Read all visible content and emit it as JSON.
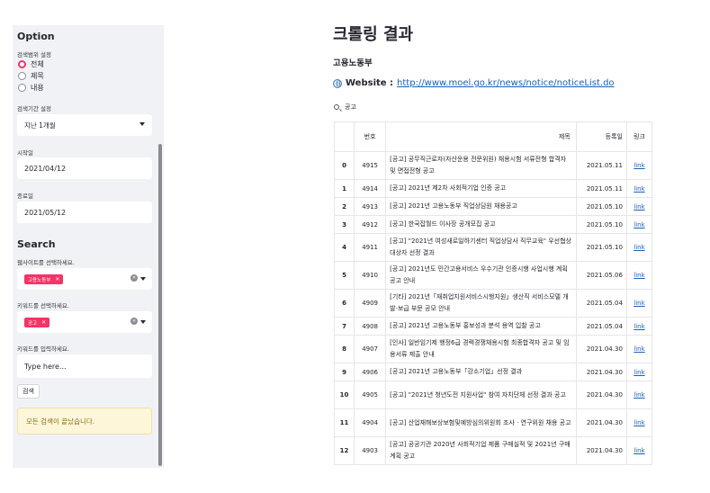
{
  "sidebar": {
    "option_title": "Option",
    "search_range_label": "검색범위 설정",
    "radio_options": [
      {
        "label": "전체",
        "checked": true
      },
      {
        "label": "제목",
        "checked": false
      },
      {
        "label": "내용",
        "checked": false
      }
    ],
    "period_label": "검색기간 설정",
    "period_value": "지난 1개월",
    "start_label": "시작일",
    "start_value": "2021/04/12",
    "end_label": "종료일",
    "end_value": "2021/05/12",
    "search_title": "Search",
    "website_label": "웹사이트를 선택하세요.",
    "website_tag": "고용노동부",
    "keyword_label": "키워드를 선택하세요.",
    "keyword_tag": "공고",
    "input_label": "키워드를 입력하세요.",
    "input_placeholder": "Type here...",
    "search_button": "검색",
    "info_message": "모든 검색이 끝났습니다."
  },
  "main": {
    "title": "크롤링 결과",
    "subtitle": "고용노동부",
    "website_label": "Website :",
    "website_url": "http://www.moel.go.kr/news/notice/noticeList.do",
    "search_keyword": "공고",
    "table": {
      "headers": [
        "",
        "번호",
        "제목",
        "등록일",
        "링크"
      ],
      "rows": [
        {
          "idx": "0",
          "num": "4915",
          "title": "[공고] 공무직근로자(자산운용 전문위원) 채용시험 서류전형 합격자 및 면접전형 공고",
          "date": "2021.05.11",
          "link": "link"
        },
        {
          "idx": "1",
          "num": "4914",
          "title": "[공고] 2021년 제2차 사회적기업 인증 공고",
          "date": "2021.05.11",
          "link": "link"
        },
        {
          "idx": "2",
          "num": "4913",
          "title": "[공고] 2021년 고용노동부 직업상담원 채용공고",
          "date": "2021.05.10",
          "link": "link"
        },
        {
          "idx": "3",
          "num": "4912",
          "title": "[공고] 한국잡월드 이사장 공개모집 공고",
          "date": "2021.05.10",
          "link": "link"
        },
        {
          "idx": "4",
          "num": "4911",
          "title": "[공고] \"2021년 여성새로일하기센터 직업상담사 직무교육\" 우선협상 대상자 선정 결과",
          "date": "2021.05.10",
          "link": "link"
        },
        {
          "idx": "5",
          "num": "4910",
          "title": "[공고] 2021년도 민간고용서비스 우수기관 인증시행 사업시행 계획공고 안내",
          "date": "2021.05.06",
          "link": "link"
        },
        {
          "idx": "6",
          "num": "4909",
          "title": "[기타] 2021년「재취업지원서비스시행지원」생산직 서비스모델 개발·보급 부문 공모 안내",
          "date": "2021.05.04",
          "link": "link"
        },
        {
          "idx": "7",
          "num": "4908",
          "title": "[공고] 2021년 고용노동부 홍보성과 분석 용역 입찰 공고",
          "date": "2021.05.04",
          "link": "link"
        },
        {
          "idx": "8",
          "num": "4907",
          "title": "[인사] 일반임기제 행정6급 경력경쟁채용시험 최종합격자 공고 및 임용서류 제출 안내",
          "date": "2021.04.30",
          "link": "link"
        },
        {
          "idx": "9",
          "num": "4906",
          "title": "[공고] 2021년 고용노동부「강소기업」선정 결과",
          "date": "2021.04.30",
          "link": "link"
        },
        {
          "idx": "10",
          "num": "4905",
          "title": "[공고] \"2021년 청년도전 지원사업\" 참여 자치단체 선정 결과 공고",
          "date": "2021.04.30",
          "link": "link"
        },
        {
          "idx": "11",
          "num": "4904",
          "title": "[공고] 산업재해보상보험및예방심의위원회 조사 · 연구위원 채용 공고",
          "date": "2021.04.30",
          "link": "link"
        },
        {
          "idx": "12",
          "num": "4903",
          "title": "[공고] 공공기관 2020년 사회적기업 제품 구매실적 및 2021년 구매계획 공고",
          "date": "2021.04.30",
          "link": "link"
        }
      ]
    }
  },
  "colors": {
    "accent": "#f63366",
    "sidebar_bg": "#f0f2f6",
    "link": "#1a5fb4",
    "info_bg": "#fdf6d9"
  }
}
